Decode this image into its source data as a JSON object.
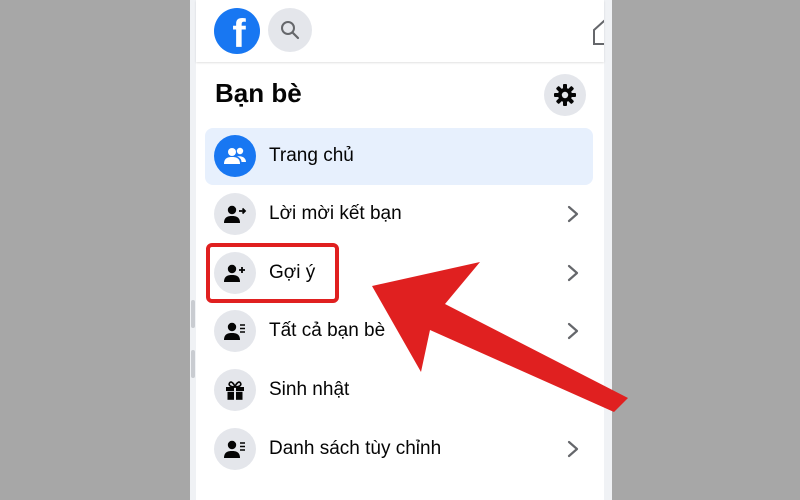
{
  "header": {
    "title": "Bạn bè"
  },
  "icons": {
    "logo": "facebook-logo",
    "search": "search-icon",
    "settings": "gear-icon"
  },
  "menu": {
    "items": [
      {
        "label": "Trang chủ",
        "icon": "friends-icon",
        "active": true,
        "chevron": false
      },
      {
        "label": "Lời mời kết bạn",
        "icon": "friend-request-icon",
        "active": false,
        "chevron": true
      },
      {
        "label": "Gợi ý",
        "icon": "add-friend-icon",
        "active": false,
        "chevron": true
      },
      {
        "label": "Tất cả bạn bè",
        "icon": "friend-list-icon",
        "active": false,
        "chevron": true
      },
      {
        "label": "Sinh nhật",
        "icon": "gift-icon",
        "active": false,
        "chevron": false
      },
      {
        "label": "Danh sách tùy chỉnh",
        "icon": "custom-list-icon",
        "active": false,
        "chevron": true
      }
    ]
  },
  "colors": {
    "brand": "#1877f2",
    "annotation": "#e02020",
    "active_bg": "#e7f0fd",
    "icon_bg": "#e4e6eb"
  }
}
